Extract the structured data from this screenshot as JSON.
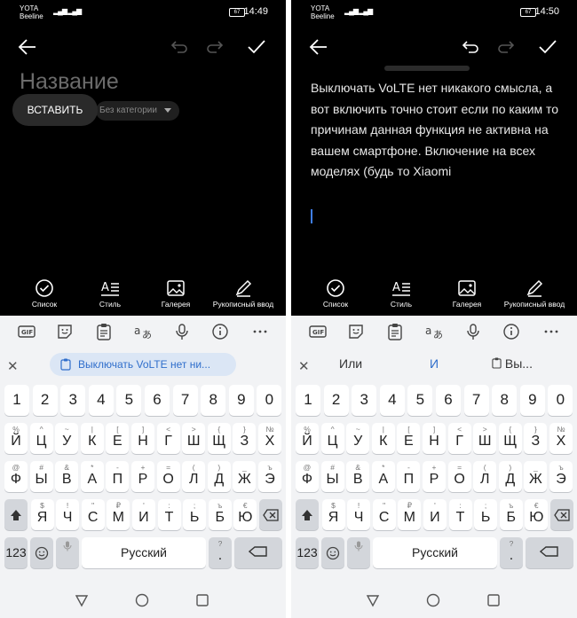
{
  "left": {
    "status": {
      "carrier1": "YOTA",
      "carrier2": "Beeline",
      "battery": "67",
      "time": "14:49"
    },
    "title_placeholder": "Название",
    "paste_popup": "ВСТАВИТЬ",
    "category": "Без категории",
    "tools": [
      "Список",
      "Стиль",
      "Галерея",
      "Рукописный ввод"
    ],
    "clipboard_chip": "Выключать VoLTE нет ни...",
    "keyboard": {
      "numbers": [
        "1",
        "2",
        "3",
        "4",
        "5",
        "6",
        "7",
        "8",
        "9",
        "0"
      ],
      "row1": {
        "keys": [
          "Й",
          "Ц",
          "У",
          "К",
          "Е",
          "Н",
          "Г",
          "Ш",
          "Щ",
          "З",
          "Х"
        ],
        "subs": [
          "%",
          "^",
          "~",
          "|",
          "[",
          "]",
          "<",
          ">",
          "{",
          "}",
          "№"
        ]
      },
      "row2": {
        "keys": [
          "Ф",
          "Ы",
          "В",
          "А",
          "П",
          "Р",
          "О",
          "Л",
          "Д",
          "Ж",
          "Э"
        ],
        "subs": [
          "@",
          "#",
          "&",
          "*",
          "-",
          "+",
          "=",
          "(",
          ")",
          "_",
          "ъ"
        ]
      },
      "row3": {
        "keys": [
          "Я",
          "Ч",
          "С",
          "М",
          "И",
          "Т",
          "Ь",
          "Б",
          "Ю"
        ],
        "subs": [
          "$",
          "!",
          "\"",
          "₽",
          "'",
          ":",
          ";",
          "ъ",
          "€"
        ]
      },
      "bottom": {
        "num": "123",
        "space": "Русский",
        "comma_sub": ",",
        "period_sub": "?"
      }
    }
  },
  "right": {
    "status": {
      "carrier1": "YOTA",
      "carrier2": "Beeline",
      "battery": "67",
      "time": "14:50"
    },
    "note_text": "Выключать VoLTE нет никакого смысла, а вот включить точно стоит если по каким то причинам данная функция не активна на вашем смартфоне. Включение на всех моделях (будь то Xiaomi",
    "tools": [
      "Список",
      "Стиль",
      "Галерея",
      "Рукописный ввод"
    ],
    "suggestions": [
      "Или",
      "И",
      "Вы..."
    ],
    "keyboard": {
      "numbers": [
        "1",
        "2",
        "3",
        "4",
        "5",
        "6",
        "7",
        "8",
        "9",
        "0"
      ],
      "row1": {
        "keys": [
          "Й",
          "Ц",
          "У",
          "К",
          "Е",
          "Н",
          "Г",
          "Ш",
          "Щ",
          "З",
          "Х"
        ],
        "subs": [
          "%",
          "^",
          "~",
          "|",
          "[",
          "]",
          "<",
          ">",
          "{",
          "}",
          "№"
        ]
      },
      "row2": {
        "keys": [
          "Ф",
          "Ы",
          "В",
          "А",
          "П",
          "Р",
          "О",
          "Л",
          "Д",
          "Ж",
          "Э"
        ],
        "subs": [
          "@",
          "#",
          "&",
          "*",
          "-",
          "+",
          "=",
          "(",
          ")",
          "_",
          "ъ"
        ]
      },
      "row3": {
        "keys": [
          "Я",
          "Ч",
          "С",
          "М",
          "И",
          "Т",
          "Ь",
          "Б",
          "Ю"
        ],
        "subs": [
          "$",
          "!",
          "\"",
          "₽",
          "'",
          ":",
          ";",
          "ъ",
          "€"
        ]
      },
      "bottom": {
        "num": "123",
        "space": "Русский",
        "comma_sub": ",",
        "period_sub": "?"
      }
    }
  },
  "keyboard_top_icons": [
    "gif-icon",
    "sticker-icon",
    "clipboard-icon",
    "translate-icon",
    "microphone-icon",
    "info-icon",
    "more-icon"
  ],
  "nav_icons": [
    "back-triangle-icon",
    "home-circle-icon",
    "recents-square-icon"
  ]
}
